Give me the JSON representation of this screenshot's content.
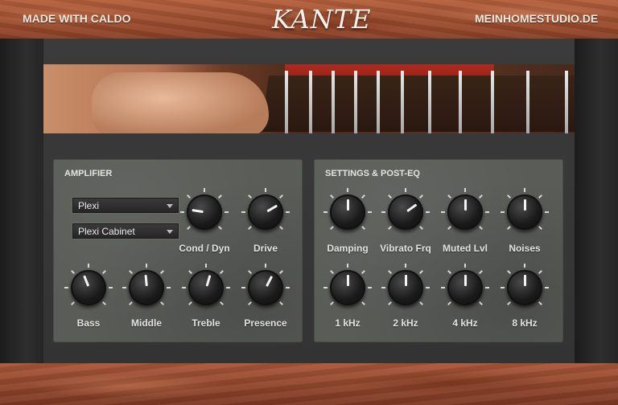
{
  "header": {
    "left_text": "MADE WITH CALDO",
    "logo": "KANTE",
    "right_text": "MEINHOMESTUDIO.DE"
  },
  "amplifier": {
    "title": "AMPLIFIER",
    "amp_select": "Plexi",
    "cabinet_select": "Plexi Cabinet",
    "knobs": {
      "cond_dyn": {
        "label": "Cond / Dyn",
        "value": 0.2
      },
      "drive": {
        "label": "Drive",
        "value": 0.72
      },
      "bass": {
        "label": "Bass",
        "value": 0.42
      },
      "middle": {
        "label": "Middle",
        "value": 0.48
      },
      "treble": {
        "label": "Treble",
        "value": 0.56
      },
      "presence": {
        "label": "Presence",
        "value": 0.6
      }
    }
  },
  "settings": {
    "title": "SETTINGS & POST-EQ",
    "knobs": {
      "damping": {
        "label": "Damping",
        "value": 0.5
      },
      "vibrato_frq": {
        "label": "Vibrato Frq",
        "value": 0.7
      },
      "muted_lvl": {
        "label": "Muted Lvl",
        "value": 0.5
      },
      "noises": {
        "label": "Noises",
        "value": 0.5
      },
      "eq_1k": {
        "label": "1 kHz",
        "value": 0.5
      },
      "eq_2k": {
        "label": "2 kHz",
        "value": 0.5
      },
      "eq_4k": {
        "label": "4 kHz",
        "value": 0.5
      },
      "eq_8k": {
        "label": "8 kHz",
        "value": 0.5
      }
    }
  },
  "colors": {
    "wood": "#a5583a",
    "panel": "#5a5c58",
    "knob": "#1a1a1a",
    "text": "#e2e2de"
  }
}
